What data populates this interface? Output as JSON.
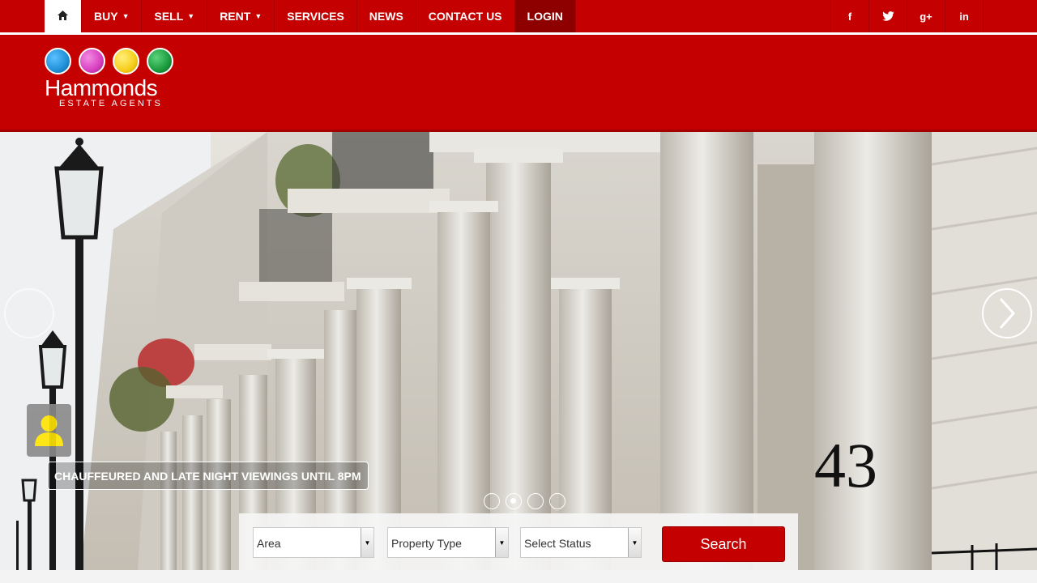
{
  "nav": {
    "items": [
      {
        "label": "BUY",
        "dropdown": true
      },
      {
        "label": "SELL",
        "dropdown": true
      },
      {
        "label": "RENT",
        "dropdown": true
      },
      {
        "label": "SERVICES",
        "dropdown": false
      },
      {
        "label": "NEWS",
        "dropdown": false
      },
      {
        "label": "CONTACT US",
        "dropdown": false
      },
      {
        "label": "LOGIN",
        "dropdown": false
      }
    ],
    "home_icon": "home-icon",
    "social": [
      {
        "label": "f",
        "icon": "facebook-icon"
      },
      {
        "label": "t",
        "icon": "twitter-icon"
      },
      {
        "label": "g+",
        "icon": "googleplus-icon"
      },
      {
        "label": "in",
        "icon": "linkedin-icon"
      }
    ]
  },
  "brand": {
    "name": "Hammonds",
    "tagline": "ESTATE AGENTS",
    "dot_colors": [
      "#1f8fd6",
      "#d63fbf",
      "#f6cc1a",
      "#1a9a3c"
    ]
  },
  "hero": {
    "caption": "CHAUFFEURED AND LATE NIGHT VIEWINGS UNTIL 8PM",
    "house_number": "43",
    "slides": 4,
    "active_slide": 2
  },
  "search": {
    "area": "Area",
    "property_type": "Property Type",
    "status": "Select Status",
    "button": "Search"
  },
  "colors": {
    "primary": "#c40000",
    "dark": "#8e0000"
  }
}
